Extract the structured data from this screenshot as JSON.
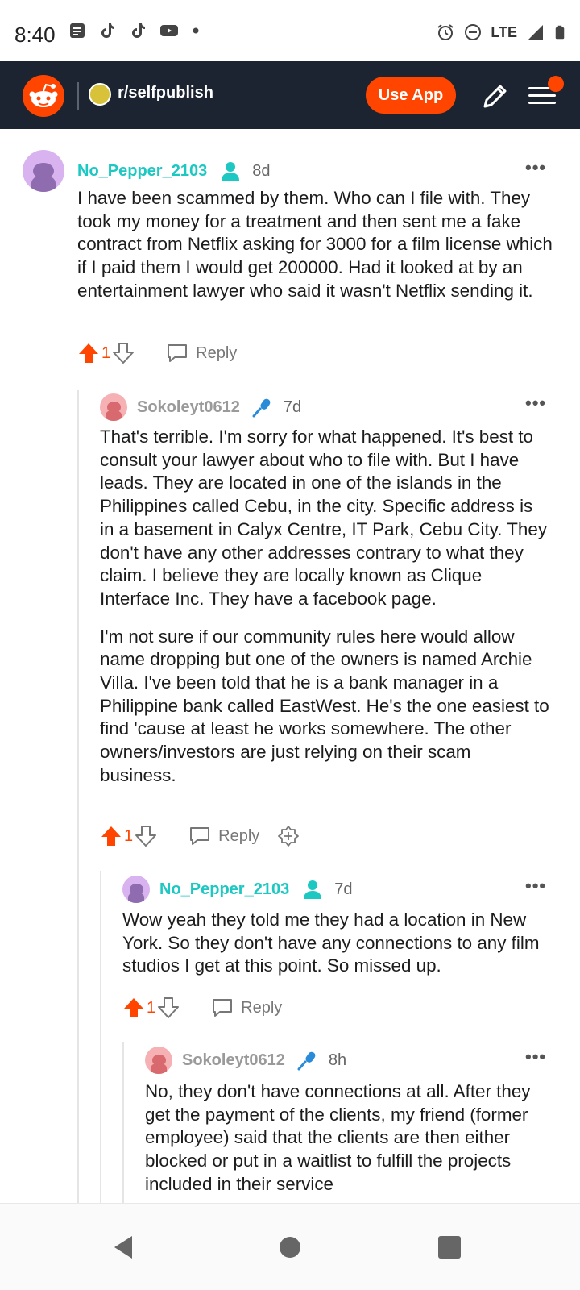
{
  "status_bar": {
    "time": "8:40",
    "network": "LTE",
    "left_icons": [
      "notes-icon",
      "tiktok-icon",
      "tiktok-icon",
      "youtube-icon",
      "dot-icon"
    ],
    "right_icons": [
      "alarm-icon",
      "dnd-icon",
      "signal-icon",
      "battery-icon"
    ]
  },
  "header": {
    "subreddit": "r/selfpublish",
    "use_app_label": "Use App"
  },
  "colors": {
    "brand": "#ff4500",
    "header_bg": "#1b2430",
    "teal_user": "#1ec8c2",
    "grey_user": "#9a9a9a"
  },
  "comments": [
    {
      "username": "No_Pepper_2103",
      "age": "8d",
      "flair_icon": "person-icon",
      "body": [
        "I have been scammed by them. Who can I file with. They took my money for a treatment and then sent me a fake contract from Netflix asking for 3000 for a film license which if I paid them I would get 200000. Had it looked at by an entertainment lawyer who said it wasn't Netflix sending it."
      ],
      "votes": "1",
      "reply_label": "Reply"
    },
    {
      "username": "Sokoleyt0612",
      "age": "7d",
      "flair_icon": "microphone-icon",
      "body": [
        "That's terrible. I'm sorry for what happened. It's best to consult your lawyer about who to file with. But I have leads. They are located in one of the islands in the Philippines called Cebu, in the city. Specific address is in a basement in Calyx Centre, IT Park, Cebu City. They don't have any other addresses contrary to what they claim. I believe they are locally known as Clique Interface Inc. They have a facebook page.",
        "I'm not sure if our community rules here would allow name dropping but one of the owners is named Archie Villa. I've been told that he is a bank manager in a Philippine bank called EastWest. He's the one easiest to find 'cause at least he works somewhere. The other owners/investors are just relying on their scam business."
      ],
      "votes": "1",
      "reply_label": "Reply"
    },
    {
      "username": "No_Pepper_2103",
      "age": "7d",
      "flair_icon": "person-icon",
      "body": [
        "Wow yeah they told me they had a location in New York. So they don't have any connections to any film studios I get at this point. So missed up."
      ],
      "votes": "1",
      "reply_label": "Reply"
    },
    {
      "username": "Sokoleyt0612",
      "age": "8h",
      "flair_icon": "microphone-icon",
      "body": [
        "No, they don't have connections at all. After they get the payment of the clients, my friend (former employee) said that the clients are then either blocked or put in a waitlist to fulfill the projects included in their service"
      ]
    }
  ],
  "nav": [
    "back-icon",
    "home-icon",
    "recents-icon"
  ]
}
